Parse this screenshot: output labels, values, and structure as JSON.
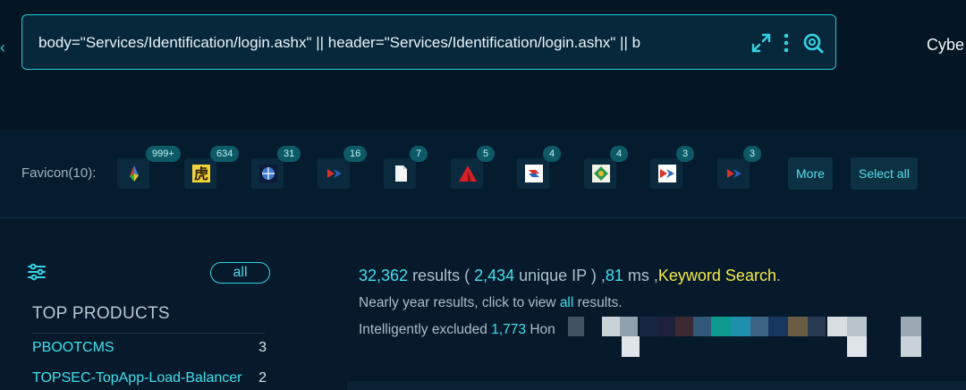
{
  "search": {
    "query": "body=\"Services/Identification/login.ashx\" || header=\"Services/Identification/login.ashx\" || b"
  },
  "header": {
    "brand_partial": "Cybe"
  },
  "favicons": {
    "label": "Favicon(10):",
    "items": [
      {
        "icon": "multicolor-shard-logo",
        "count": "999+"
      },
      {
        "icon": "yellow-tiger-glyph",
        "count": "634"
      },
      {
        "icon": "blue-globe-badge",
        "count": "31"
      },
      {
        "icon": "red-blue-chevron-logo",
        "count": "16"
      },
      {
        "icon": "blank-document",
        "count": "7"
      },
      {
        "icon": "red-triangle-logo",
        "count": "5"
      },
      {
        "icon": "blue-red-s-logo",
        "count": "4"
      },
      {
        "icon": "green-diamond-emblem",
        "count": "4"
      },
      {
        "icon": "red-blue-chevron-logo",
        "count": "3"
      },
      {
        "icon": "red-blue-chevron-logo",
        "count": "3"
      }
    ],
    "more_label": "More",
    "select_all_label": "Select all"
  },
  "sidebar": {
    "all_label": "all",
    "top_products_title": "TOP PRODUCTS",
    "products": [
      {
        "name": "PBOOTCMS",
        "count": "3"
      },
      {
        "name": "TOPSEC-TopApp-Load-Balancer",
        "count": "2"
      }
    ]
  },
  "summary": {
    "results_count": "32,362",
    "results_word": " results ( ",
    "unique_ip_count": "2,434",
    "unique_ip_word": " unique IP ) ,",
    "ms": "81",
    "ms_word": " ms ,",
    "keyword_search": "Keyword Search",
    "period": ".",
    "nearly_year_prefix": "Nearly year results, click to view ",
    "nearly_year_link": "all",
    "nearly_year_suffix": " results.",
    "excluded_prefix": "Intelligently excluded ",
    "excluded_count": "1,773",
    "excluded_suffix": " Hon"
  },
  "colors": {
    "accent": "#35d4e3",
    "keyword": "#f5e84a",
    "background": "#061a2b",
    "badge": "#0d5a66"
  }
}
